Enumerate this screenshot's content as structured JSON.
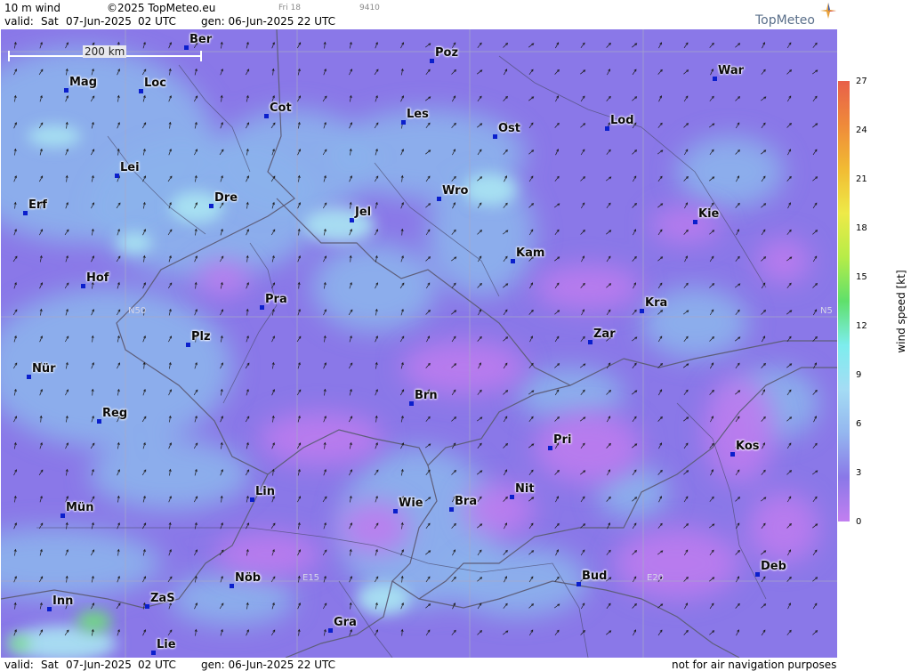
{
  "header": {
    "product": "10 m wind",
    "copyright": "©2025 TopMeteo.eu",
    "run_tag": "Fri 18",
    "code": "9410",
    "valid_label": "valid:",
    "valid_day": "Sat",
    "valid_date": "07-Jun-2025",
    "valid_time": "02 UTC",
    "gen_label": "gen: 06-Jun-2025 22 UTC",
    "brand": "TopMeteo"
  },
  "footer": {
    "valid_label": "valid:",
    "valid_day": "Sat",
    "valid_date": "07-Jun-2025",
    "valid_time": "02 UTC",
    "gen_label": "gen: 06-Jun-2025 22 UTC",
    "disclaimer": "not for air navigation purposes"
  },
  "scale_bar": {
    "label": "200 km"
  },
  "grid_labels": {
    "lat_left": "N50",
    "lat_right": "N5",
    "lon_a": "E15",
    "lon_b": "E20"
  },
  "cities": [
    {
      "name": "Ber"
    },
    {
      "name": "Poz"
    },
    {
      "name": "War"
    },
    {
      "name": "Mag"
    },
    {
      "name": "Loc"
    },
    {
      "name": "Cot"
    },
    {
      "name": "Les"
    },
    {
      "name": "Ost"
    },
    {
      "name": "Lod"
    },
    {
      "name": "Lei"
    },
    {
      "name": "Erf"
    },
    {
      "name": "Dre"
    },
    {
      "name": "Jel"
    },
    {
      "name": "Wro"
    },
    {
      "name": "Kie"
    },
    {
      "name": "Kam"
    },
    {
      "name": "Hof"
    },
    {
      "name": "Pra"
    },
    {
      "name": "Kra"
    },
    {
      "name": "Plz"
    },
    {
      "name": "Zar"
    },
    {
      "name": "Nür"
    },
    {
      "name": "Brn"
    },
    {
      "name": "Reg"
    },
    {
      "name": "Pri"
    },
    {
      "name": "Kos"
    },
    {
      "name": "Lin"
    },
    {
      "name": "Nit"
    },
    {
      "name": "Mün"
    },
    {
      "name": "Wie"
    },
    {
      "name": "Bra"
    },
    {
      "name": "Deb"
    },
    {
      "name": "Nöb"
    },
    {
      "name": "Bud"
    },
    {
      "name": "Inn"
    },
    {
      "name": "ZaS"
    },
    {
      "name": "Gra"
    },
    {
      "name": "Lie"
    }
  ],
  "legend": {
    "title": "wind speed [kt]",
    "ticks": [
      "27",
      "24",
      "21",
      "18",
      "15",
      "12",
      "9",
      "6",
      "3",
      "0"
    ],
    "colors": [
      "#e8604a",
      "#ef8a3a",
      "#f1bb33",
      "#eeea48",
      "#b6ec48",
      "#5fe06b",
      "#7dedee",
      "#a4dcf4",
      "#94b6ef",
      "#8a78e8",
      "#c27ff0"
    ]
  },
  "colors": {
    "calm": "#bd7bee",
    "light": "#8a78e8",
    "moderate": "#8cb2ec",
    "fresh": "#aae6f2",
    "strong": "#6fe079",
    "dot": "#0b1fcc"
  }
}
